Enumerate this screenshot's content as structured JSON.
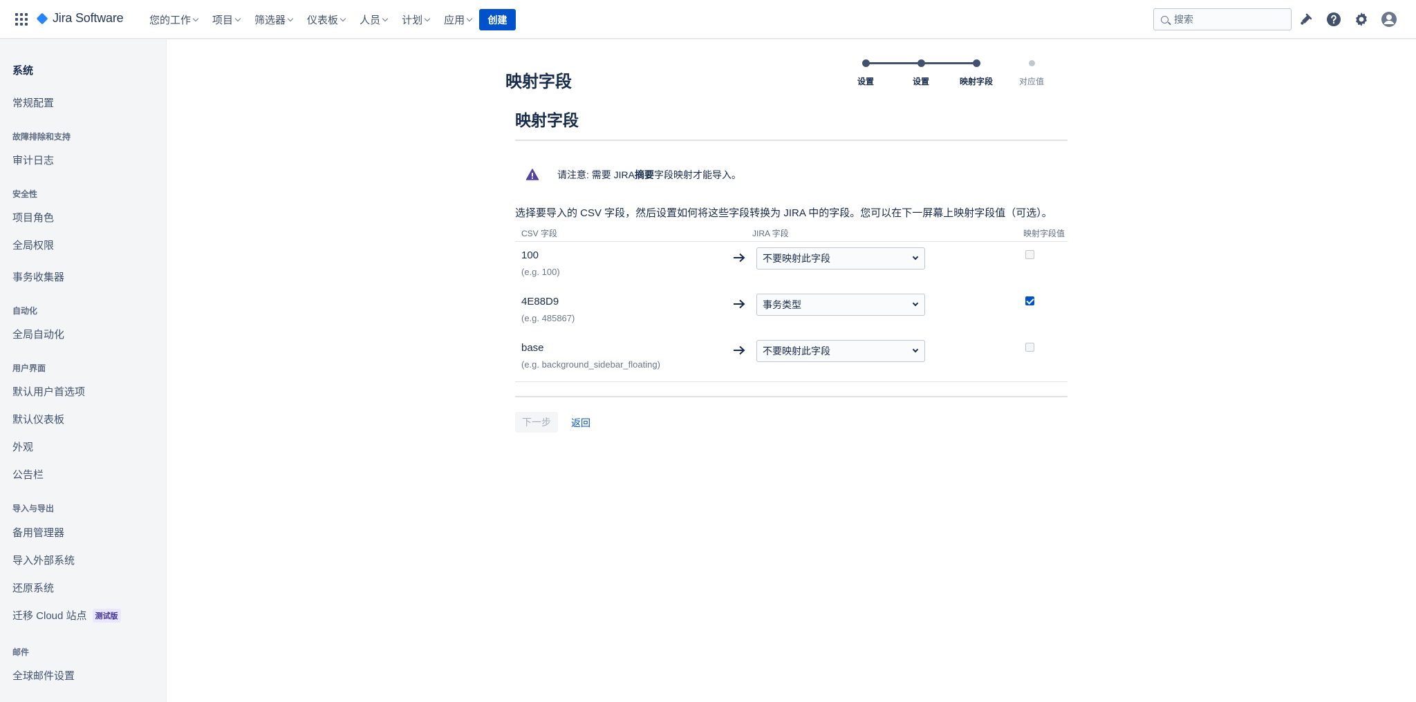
{
  "header": {
    "logo_text": "Jira Software",
    "nav": [
      {
        "label": "您的工作"
      },
      {
        "label": "项目"
      },
      {
        "label": "筛选器"
      },
      {
        "label": "仪表板"
      },
      {
        "label": "人员"
      },
      {
        "label": "计划"
      },
      {
        "label": "应用"
      }
    ],
    "create_label": "创建",
    "search_placeholder": "搜索",
    "icons": [
      "app-switcher-icon",
      "notification-icon",
      "help-icon",
      "settings-icon",
      "profile-icon"
    ]
  },
  "sidebar": {
    "heading": "系统",
    "top_item": "常规配置",
    "groups": [
      {
        "title": "故障排除和支持",
        "items": [
          "审计日志"
        ]
      },
      {
        "title": "安全性",
        "items": [
          "项目角色",
          "全局权限",
          "事务收集器"
        ]
      },
      {
        "title": "自动化",
        "items": [
          "全局自动化"
        ]
      },
      {
        "title": "用户界面",
        "items": [
          "默认用户首选项",
          "默认仪表板",
          "外观",
          "公告栏"
        ]
      },
      {
        "title": "导入与导出",
        "items": [
          "备用管理器",
          "导入外部系统",
          "还原系统",
          "迁移 Cloud 站点"
        ]
      },
      {
        "title": "邮件",
        "items": [
          "全球邮件设置"
        ]
      }
    ],
    "badge": "测试版"
  },
  "main": {
    "page_title": "映射字段",
    "progress": {
      "steps": [
        {
          "label": "设置",
          "done": true
        },
        {
          "label": "设置",
          "done": true
        },
        {
          "label": "映射字段",
          "done": true
        },
        {
          "label": "对应值",
          "done": false
        }
      ]
    },
    "section_title": "映射字段",
    "notice": {
      "prefix": "请注意: 需要 JIRA",
      "bold": "摘要",
      "suffix": "字段映射才能导入。"
    },
    "intro": "选择要导入的 CSV 字段，然后设置如何将这些字段转换为 JIRA 中的字段。您可以在下一屏幕上映射字段值（可选）。",
    "columns": {
      "csv": "CSV 字段",
      "jira": "JIRA 字段",
      "map_values": "映射字段值"
    },
    "rows": [
      {
        "name": "100",
        "example": "(e.g. 100)",
        "jira_field": "不要映射此字段",
        "map_values": false
      },
      {
        "name": "4E88D9",
        "example": "(e.g. 485867)",
        "jira_field": "事务类型",
        "map_values": true
      },
      {
        "name": "base",
        "example": "(e.g. background_sidebar_floating)",
        "jira_field": "不要映射此字段",
        "map_values": false
      }
    ],
    "next_label": "下一步",
    "back_label": "返回"
  },
  "colors": {
    "primary": "#0052cc",
    "text": "#172b4d",
    "warning": "#5243aa",
    "sidebar_bg": "#f4f5f7"
  }
}
